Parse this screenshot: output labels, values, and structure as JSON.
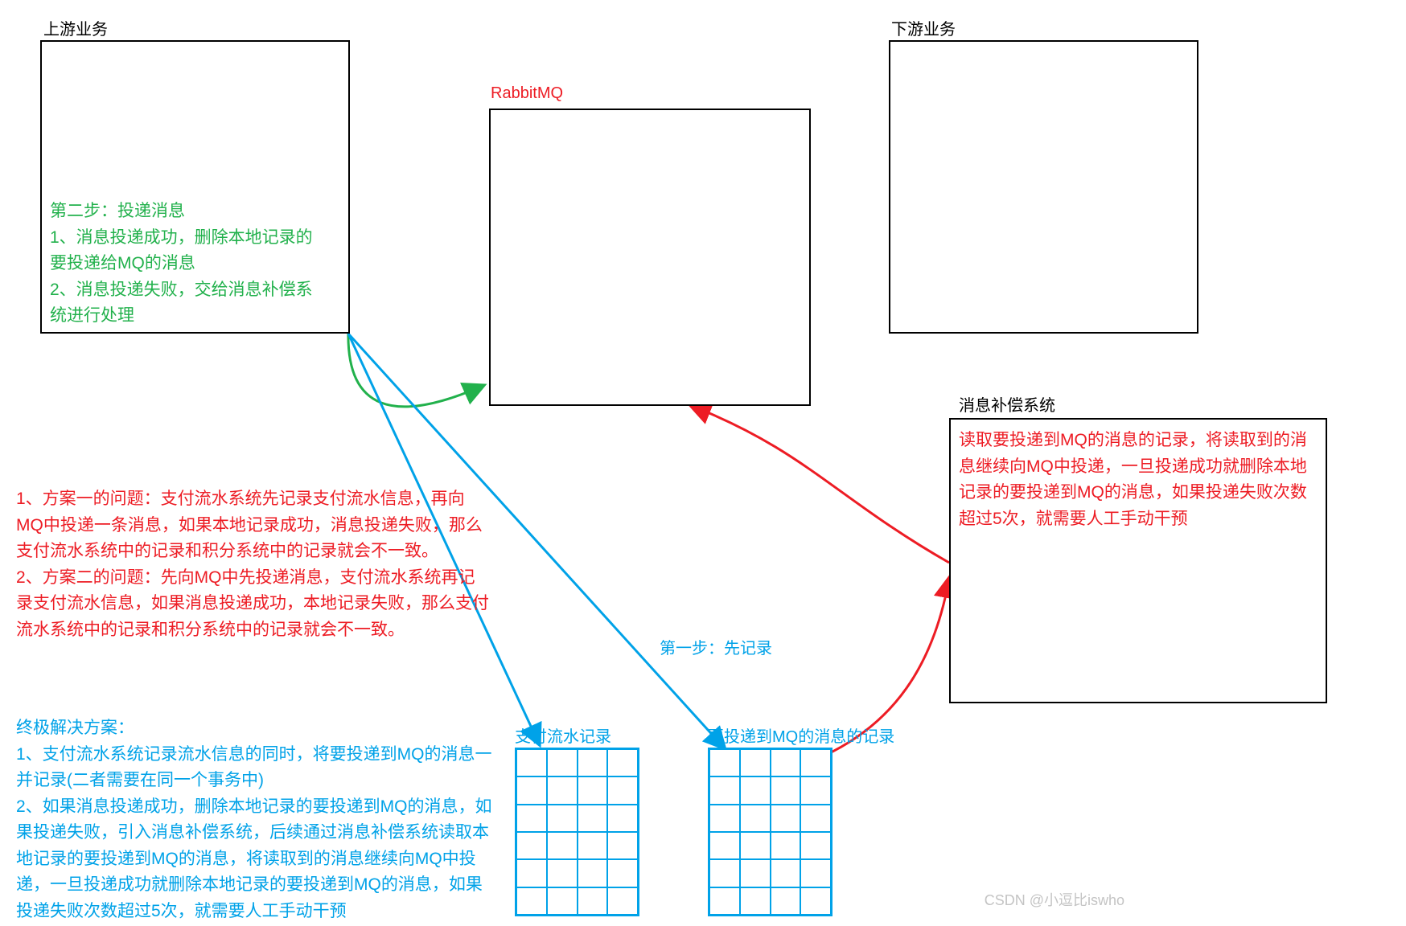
{
  "labels": {
    "upstream_title": "上游业务",
    "rabbitmq_title": "RabbitMQ",
    "downstream_title": "下游业务",
    "compensation_title": "消息补偿系统",
    "payment_grid_title": "支付流水记录",
    "mq_grid_title": "要投递到MQ的消息的记录",
    "step1_label": "第一步：先记录"
  },
  "upstream_steps": "第二步：投递消息\n1、消息投递成功，删除本地记录的要投递给MQ的消息\n2、消息投递失败，交给消息补偿系统进行处理",
  "problem_text": "1、方案一的问题：支付流水系统先记录支付流水信息，再向MQ中投递一条消息，如果本地记录成功，消息投递失败，那么支付流水系统中的记录和积分系统中的记录就会不一致。\n2、方案二的问题：先向MQ中先投递消息，支付流水系统再记录支付流水信息，如果消息投递成功，本地记录失败，那么支付流水系统中的记录和积分系统中的记录就会不一致。",
  "solution_text": "终极解决方案：\n1、支付流水系统记录流水信息的同时，将要投递到MQ的消息一并记录(二者需要在同一个事务中)\n2、如果消息投递成功，删除本地记录的要投递到MQ的消息，如果投递失败，引入消息补偿系统，后续通过消息补偿系统读取本地记录的要投递到MQ的消息，将读取到的消息继续向MQ中投递，一旦投递成功就删除本地记录的要投递到MQ的消息，如果投递失败次数超过5次，就需要人工手动干预",
  "compensation_text": "读取要投递到MQ的消息的记录，将读取到的消息继续向MQ中投递，一旦投递成功就删除本地记录的要投递到MQ的消息，如果投递失败次数超过5次，就需要人工手动干预",
  "watermark": "CSDN @小逗比iswho",
  "colors": {
    "red": "#ed1c24",
    "green": "#22b14c",
    "blue": "#00a2e8",
    "black": "#000000"
  }
}
